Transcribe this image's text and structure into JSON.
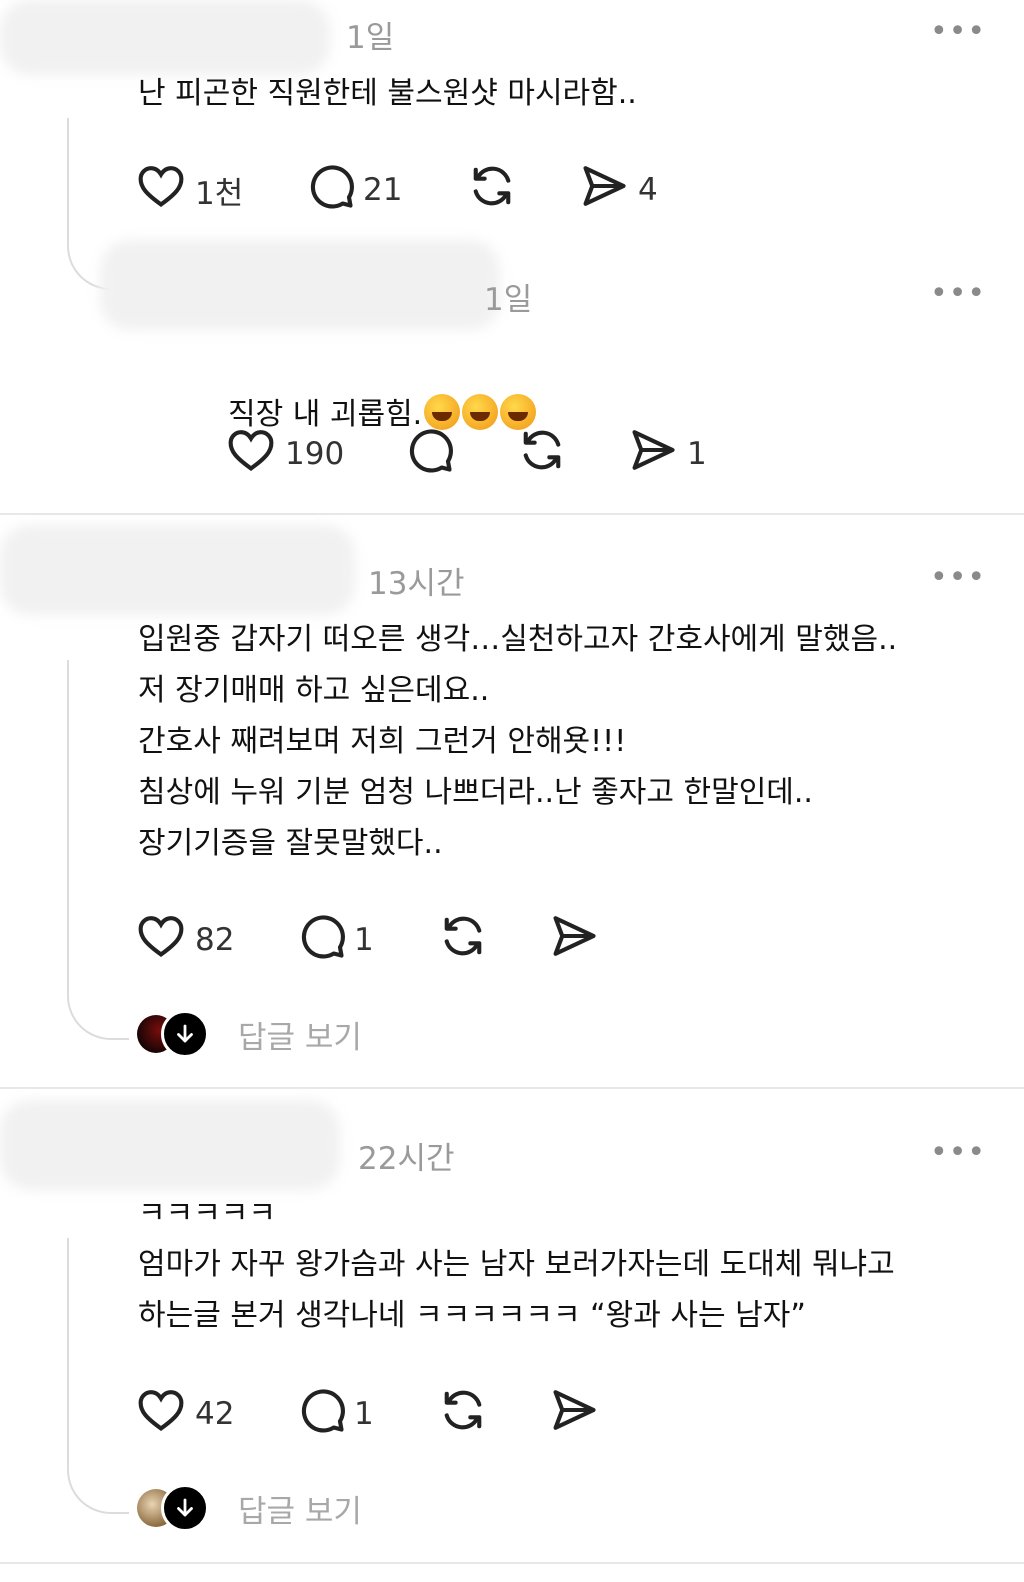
{
  "posts": [
    {
      "timestamp": "1일",
      "body": "난 피곤한 직원한테 불스원샷 마시라함..",
      "likes": "1천",
      "comments": "21",
      "reposts": "",
      "shares": "4"
    },
    {
      "timestamp": "1일",
      "body": "직장 내 괴롭힘.",
      "emoji_name": "rolling-on-floor-laughing-emoji",
      "likes": "190",
      "comments": "",
      "reposts": "",
      "shares": "1"
    },
    {
      "timestamp": "13시간",
      "body": "입원중 갑자기 떠오른 생각…실천하고자 간호사에게 말했음..\n저 장기매매 하고 싶은데요..\n간호사 째려보며 저희 그런거 안해욧!!!\n침상에 누워 기분 엄청 나쁘더라..난 좋자고 한말인데..\n장기기증을 잘못말했다..",
      "likes": "82",
      "comments": "1",
      "reposts": "",
      "shares": "",
      "view_replies": "답글 보기"
    },
    {
      "timestamp": "22시간",
      "body": "ㅋㅋㅋㅋㅋ\n엄마가 자꾸 왕가슴과 사는 남자 보러가자는데 도대체 뭐냐고\n하는글 본거 생각나네 ㅋㅋㅋㅋㅋㅋ “왕과 사는 남자”",
      "likes": "42",
      "comments": "1",
      "reposts": "",
      "shares": "",
      "view_replies": "답글 보기"
    }
  ],
  "more_icon": "•••",
  "icons": {
    "like": "heart-icon",
    "comment": "comment-bubble-icon",
    "repost": "repost-icon",
    "share": "send-icon",
    "more": "more-options-icon",
    "expand": "arrow-down-icon"
  }
}
